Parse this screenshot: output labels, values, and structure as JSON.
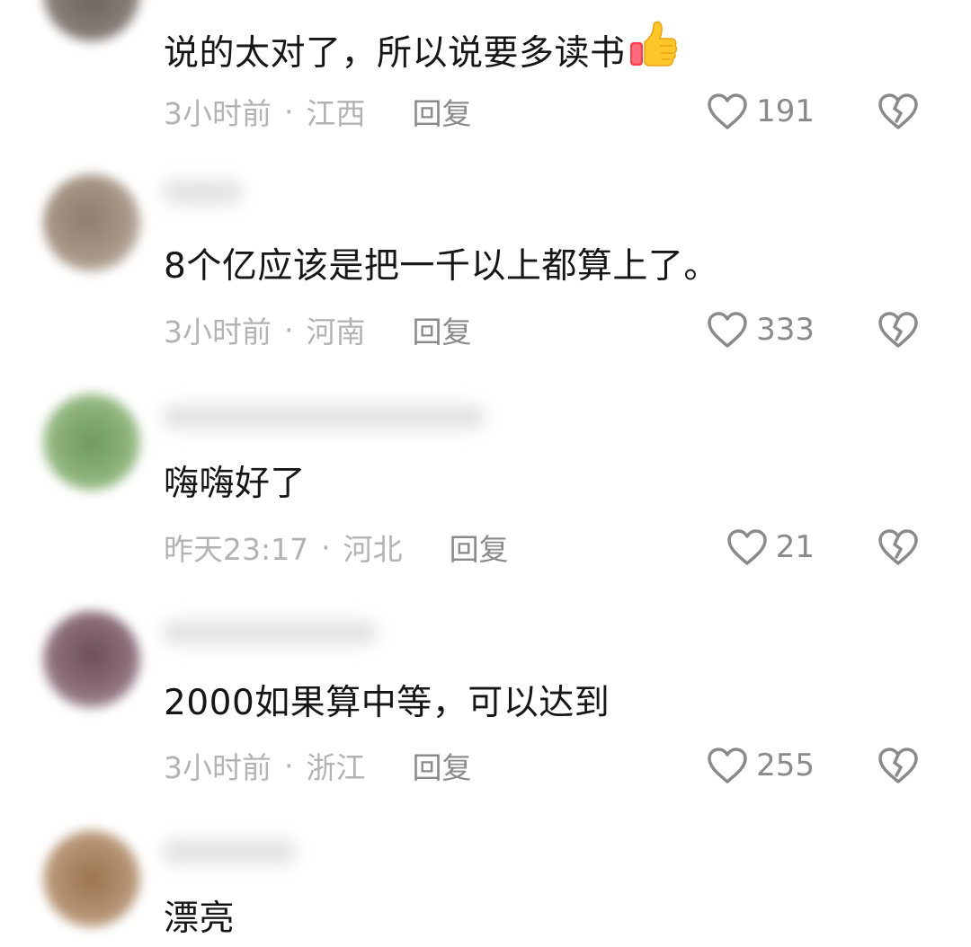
{
  "comments": [
    {
      "text": "说的太对了，所以说要多读书",
      "emoji": "thumbs-up",
      "time": "3小时前",
      "location": "江西",
      "reply_label": "回复",
      "likes": "191",
      "avatar_color": "#6e6460"
    },
    {
      "text": "8个亿应该是把一千以上都算上了。",
      "time": "3小时前",
      "location": "河南",
      "reply_label": "回复",
      "likes": "333",
      "avatar_color": "#9a8a7c"
    },
    {
      "text": "嗨嗨好了",
      "time": "昨天23:17",
      "location": "河北",
      "reply_label": "回复",
      "likes": "21",
      "avatar_color": "#7fa86a"
    },
    {
      "text": "2000如果算中等，可以达到",
      "time": "3小时前",
      "location": "浙江",
      "reply_label": "回复",
      "likes": "255",
      "avatar_color": "#7a5a66"
    },
    {
      "text": "漂亮",
      "avatar_color": "#a8825e"
    }
  ],
  "meta_separator": "·",
  "colors": {
    "meta_text": "#b3b3b3",
    "action_text": "#8a8a8a",
    "comment_text": "#161616"
  }
}
